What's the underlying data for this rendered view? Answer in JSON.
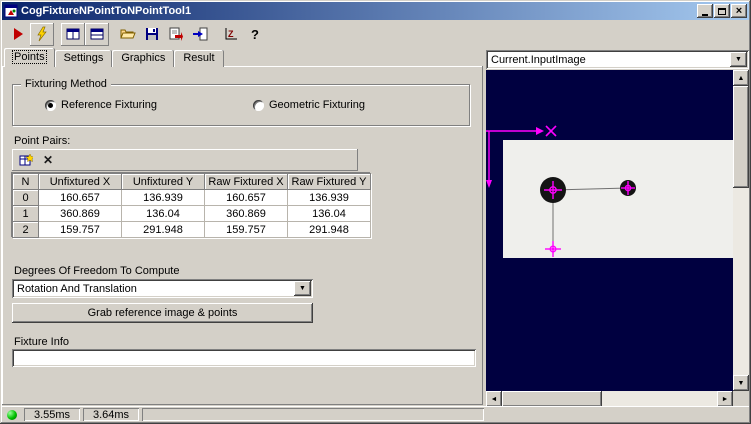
{
  "window": {
    "title": "CogFixtureNPointToNPointTool1"
  },
  "icons": {
    "close": "×",
    "dropdown": "▼",
    "scroll_up": "▲",
    "scroll_down": "▼",
    "scroll_left": "◄",
    "scroll_right": "►",
    "delete": "✕",
    "help": "?",
    "graph_letter": "Z"
  },
  "toolbar": {
    "buttons": [
      "run",
      "edit-electric",
      "split-view",
      "grid-view",
      "open",
      "save",
      "copy-results",
      "import",
      "graph",
      "help"
    ]
  },
  "tabs": [
    {
      "label": "Points",
      "active": true
    },
    {
      "label": "Settings",
      "active": false
    },
    {
      "label": "Graphics",
      "active": false
    },
    {
      "label": "Result",
      "active": false
    }
  ],
  "fixturing_method": {
    "title": "Fixturing Method",
    "options": [
      {
        "label": "Reference Fixturing",
        "selected": true
      },
      {
        "label": "Geometric Fixturing",
        "selected": false
      }
    ]
  },
  "point_pairs": {
    "label": "Point Pairs:",
    "columns": [
      "N",
      "Unfixtured X",
      "Unfixtured Y",
      "Raw Fixtured X",
      "Raw Fixtured Y"
    ],
    "rows": [
      [
        "0",
        "160.657",
        "136.939",
        "160.657",
        "136.939"
      ],
      [
        "1",
        "360.869",
        "136.04",
        "360.869",
        "136.04"
      ],
      [
        "2",
        "159.757",
        "291.948",
        "159.757",
        "291.948"
      ]
    ]
  },
  "dof": {
    "label": "Degrees Of Freedom To Compute",
    "selected": "Rotation And Translation"
  },
  "buttons": {
    "grab": "Grab reference image & points"
  },
  "fixture_info": {
    "label": "Fixture Info",
    "value": ""
  },
  "image_panel": {
    "selected_source": "Current.InputImage"
  },
  "status_bar": {
    "metrics": [
      "3.55ms",
      "3.64ms"
    ]
  },
  "colors": {
    "titlebar_start": "#0a246a",
    "titlebar_end": "#a6caf0",
    "image_background": "#000040",
    "marker_magenta": "#ff00ff",
    "status_led": "#00c000"
  }
}
